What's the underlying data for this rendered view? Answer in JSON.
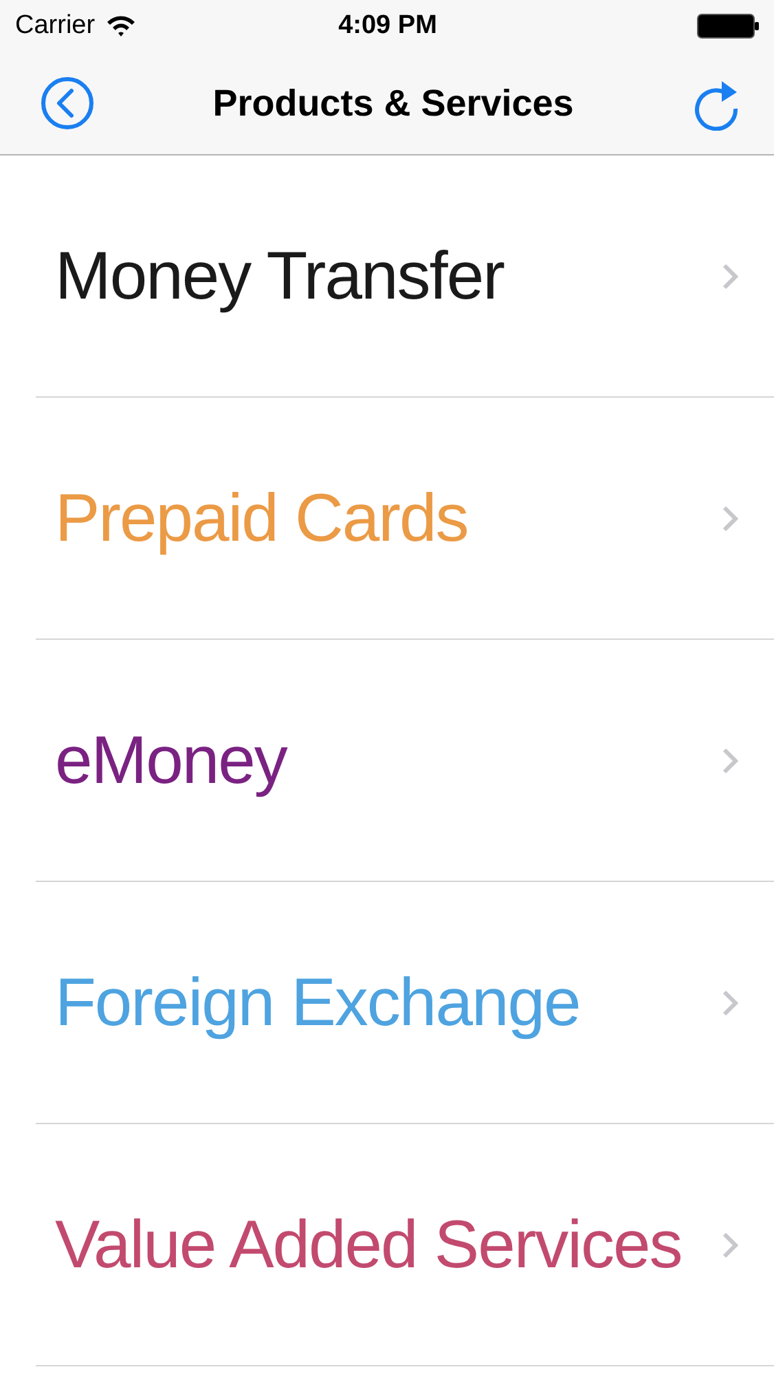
{
  "status_bar": {
    "carrier": "Carrier",
    "time": "4:09 PM"
  },
  "nav_bar": {
    "title": "Products & Services"
  },
  "items": [
    {
      "label": "Money Transfer",
      "color": "#1a1a1a"
    },
    {
      "label": "Prepaid Cards",
      "color": "#eb9a45"
    },
    {
      "label": "eMoney",
      "color": "#7a2282"
    },
    {
      "label": "Foreign Exchange",
      "color": "#4ea3e0"
    },
    {
      "label": "Value Added Services",
      "color": "#c24a6e"
    }
  ]
}
